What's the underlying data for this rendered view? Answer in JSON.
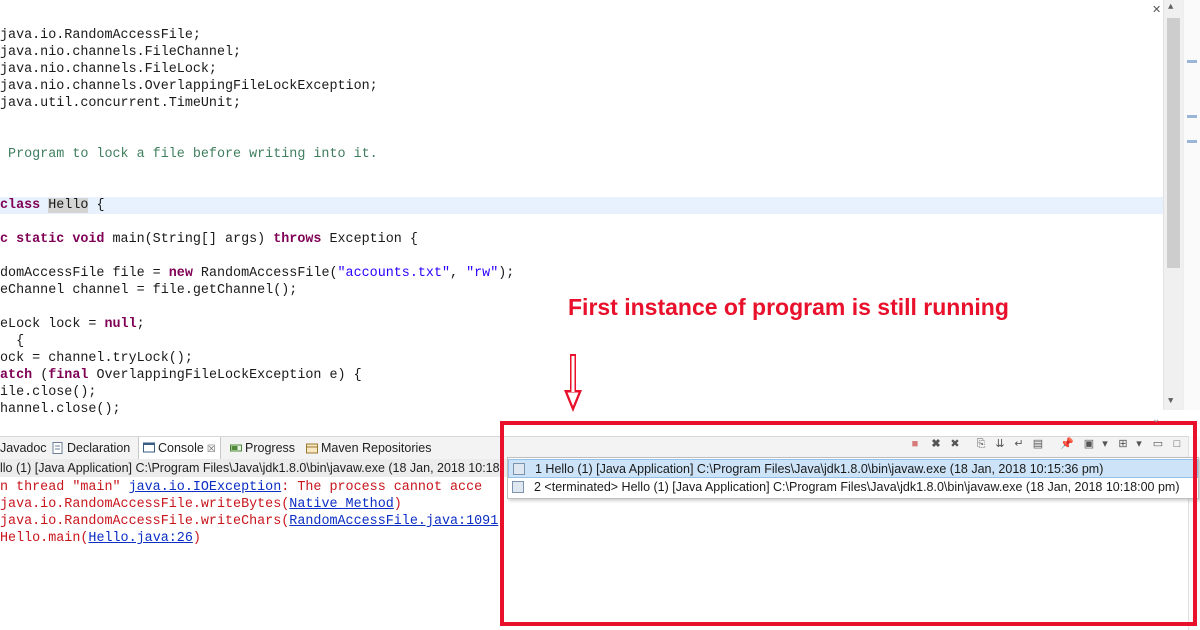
{
  "editor": {
    "lines": [
      {
        "parts": [
          {
            "t": "java.io.RandomAccessFile;"
          }
        ]
      },
      {
        "parts": [
          {
            "t": "java.nio.channels.FileChannel;"
          }
        ]
      },
      {
        "parts": [
          {
            "t": "java.nio.channels.FileLock;"
          }
        ]
      },
      {
        "parts": [
          {
            "t": "java.nio.channels.OverlappingFileLockException;"
          }
        ]
      },
      {
        "parts": [
          {
            "t": "java.util.concurrent.TimeUnit;"
          }
        ]
      },
      {
        "parts": [
          {
            "t": ""
          }
        ]
      },
      {
        "parts": [
          {
            "t": ""
          }
        ]
      },
      {
        "parts": [
          {
            "t": " Program to lock a file before writing into it.",
            "c": "cmt"
          }
        ]
      },
      {
        "parts": [
          {
            "t": ""
          }
        ]
      },
      {
        "parts": [
          {
            "t": ""
          }
        ]
      },
      {
        "parts": [
          {
            "t": "class ",
            "c": "kw"
          },
          {
            "t": "Hello",
            "c": "cls-occ"
          },
          {
            "t": " {"
          }
        ]
      },
      {
        "parts": [
          {
            "t": ""
          }
        ]
      },
      {
        "parts": [
          {
            "t": "c static void ",
            "c": "kw"
          },
          {
            "t": "main(String[] args) "
          },
          {
            "t": "throws ",
            "c": "kw"
          },
          {
            "t": "Exception {"
          }
        ]
      },
      {
        "parts": [
          {
            "t": ""
          }
        ]
      },
      {
        "parts": [
          {
            "t": "domAccessFile file = "
          },
          {
            "t": "new ",
            "c": "kw"
          },
          {
            "t": "RandomAccessFile("
          },
          {
            "t": "\"accounts.txt\"",
            "c": "str"
          },
          {
            "t": ", "
          },
          {
            "t": "\"rw\"",
            "c": "str"
          },
          {
            "t": ");"
          }
        ]
      },
      {
        "parts": [
          {
            "t": "eChannel channel = file.getChannel();"
          }
        ]
      },
      {
        "parts": [
          {
            "t": ""
          }
        ]
      },
      {
        "parts": [
          {
            "t": "eLock lock = "
          },
          {
            "t": "null",
            "c": "kw"
          },
          {
            "t": ";"
          }
        ]
      },
      {
        "parts": [
          {
            "t": "  {"
          }
        ]
      },
      {
        "parts": [
          {
            "t": "ock = channel.tryLock();"
          }
        ]
      },
      {
        "parts": [
          {
            "t": "atch ",
            "c": "kw"
          },
          {
            "t": "("
          },
          {
            "t": "final ",
            "c": "kw"
          },
          {
            "t": "OverlappingFileLockException e) {"
          }
        ]
      },
      {
        "parts": [
          {
            "t": "ile.close();"
          }
        ]
      },
      {
        "parts": [
          {
            "t": "hannel.close();"
          }
        ]
      }
    ]
  },
  "annotation": {
    "text": "First instance of program is still running",
    "color": "#e8102a"
  },
  "panel": {
    "tabs": [
      {
        "label": "Javadoc",
        "icon": "at-icon"
      },
      {
        "label": "Declaration",
        "icon": "declaration-icon"
      },
      {
        "label": "Console",
        "icon": "console-icon",
        "active": true
      },
      {
        "label": "Progress",
        "icon": "progress-icon"
      },
      {
        "label": "Maven Repositories",
        "icon": "maven-repositories-icon"
      }
    ],
    "launch_label": "llo (1) [Java Application] C:\\Program Files\\Java\\jdk1.8.0\\bin\\javaw.exe (18 Jan, 2018 10:18",
    "console_lines": [
      {
        "parts": [
          {
            "t": "n thread \"main\" "
          },
          {
            "t": "java.io.IOException",
            "c": "link"
          },
          {
            "t": ": The process cannot acce"
          }
        ]
      },
      {
        "parts": [
          {
            "t": "java.io.RandomAccessFile.writeBytes("
          },
          {
            "t": "Native Method",
            "c": "link"
          },
          {
            "t": ")"
          }
        ]
      },
      {
        "parts": [
          {
            "t": "java.io.RandomAccessFile.writeChars("
          },
          {
            "t": "RandomAccessFile.java:1091",
            "c": "link"
          },
          {
            "t": ")"
          }
        ]
      },
      {
        "parts": [
          {
            "t": "Hello.main("
          },
          {
            "t": "Hello.java:26",
            "c": "link"
          },
          {
            "t": ")"
          }
        ]
      }
    ],
    "toolbar_icons": [
      "terminate-icon",
      "remove-launch-icon",
      "remove-all-terminated-icon",
      "clear-console-icon",
      "scroll-lock-icon",
      "word-wrap-icon",
      "show-console-icon",
      "pin-console-icon",
      "display-selected-console-icon",
      "open-console-icon",
      "minimize-icon",
      "maximize-icon"
    ],
    "dropdown_items": [
      {
        "label": "1 Hello (1) [Java Application] C:\\Program Files\\Java\\jdk1.8.0\\bin\\javaw.exe (18 Jan, 2018 10:15:36 pm)",
        "selected": true
      },
      {
        "label": "2 <terminated> Hello (1) [Java Application] C:\\Program Files\\Java\\jdk1.8.0\\bin\\javaw.exe (18 Jan, 2018 10:18:00 pm)",
        "selected": false
      }
    ]
  }
}
